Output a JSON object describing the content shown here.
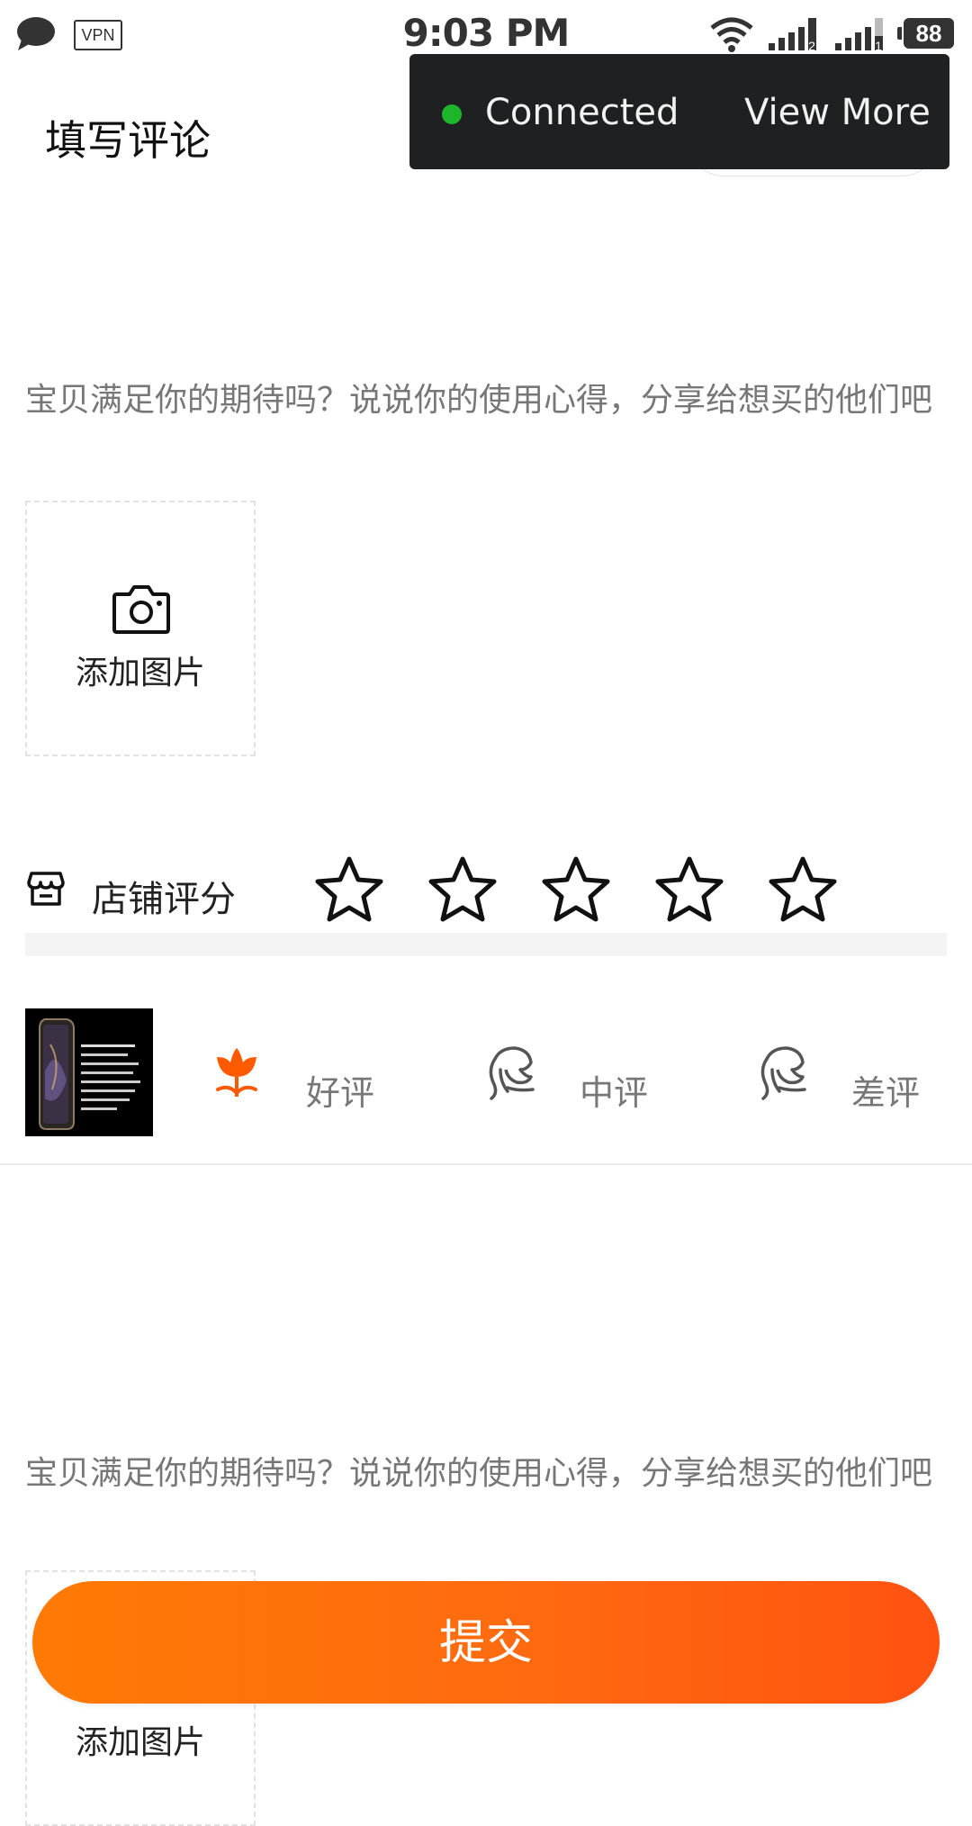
{
  "status_bar": {
    "time": "9:03 PM",
    "vpn": "VPN",
    "battery": "88",
    "sim1": "2",
    "sim2": "1"
  },
  "header": {
    "title": "填写评论"
  },
  "toast": {
    "status": "Connected",
    "action": "View More",
    "dot_color": "#1db52a"
  },
  "review_1": {
    "placeholder": "宝贝满足你的期待吗？说说你的使用心得，分享给想买的他们吧",
    "add_photo": "添加图片"
  },
  "shop_rating": {
    "label": "店铺评分",
    "stars_selected": 0,
    "stars_total": 5
  },
  "product_rating": {
    "options": [
      "好评",
      "中评",
      "差评"
    ],
    "selected": "好评",
    "accent": "#ff5a00"
  },
  "review_2": {
    "placeholder": "宝贝满足你的期待吗？说说你的使用心得，分享给想买的他们吧",
    "add_photo": "添加图片"
  },
  "submit": {
    "label": "提交"
  }
}
